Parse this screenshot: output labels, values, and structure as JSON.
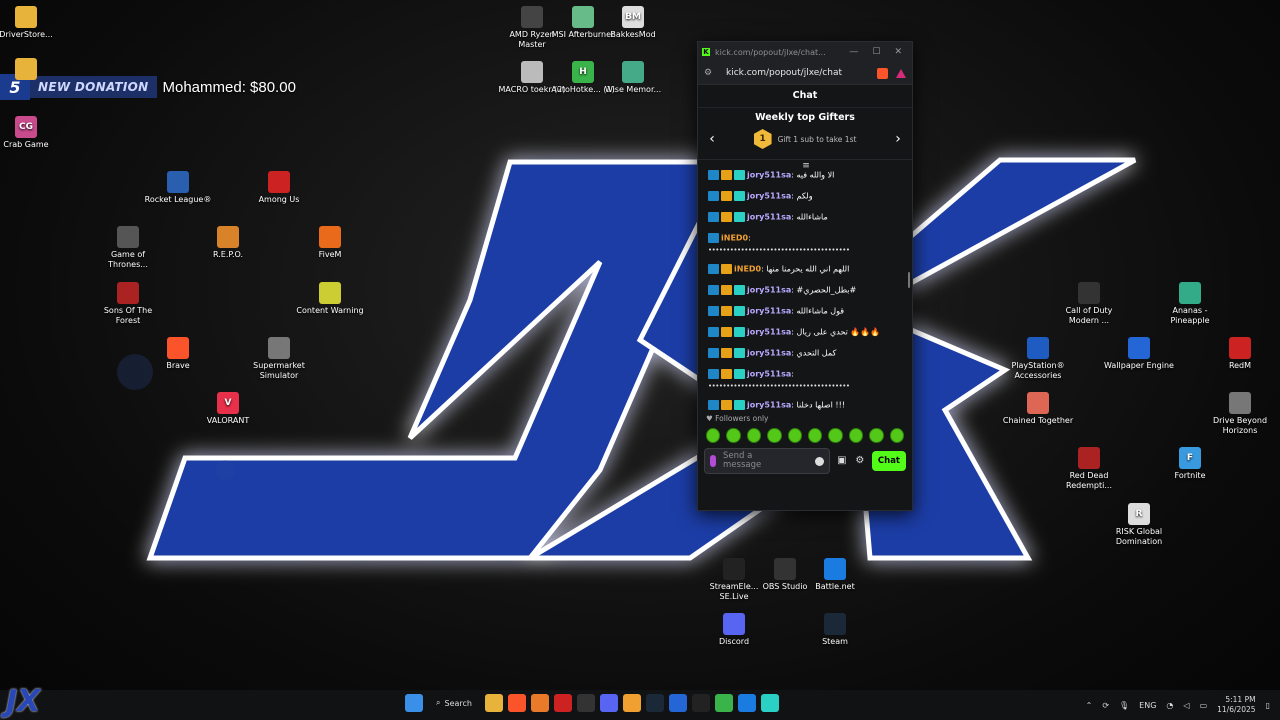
{
  "donation": {
    "badge": "5",
    "label": "NEW DONATION",
    "text": "Mohammed: $80.00"
  },
  "desktop_icons": [
    {
      "label": "DriverStore...",
      "color": "#e8b33a",
      "glyph": ""
    },
    {
      "label": "",
      "color": "#e8b33a",
      "glyph": ""
    },
    {
      "label": "Crab Game",
      "color": "#c94a8d",
      "glyph": "CG"
    },
    {
      "label": "AMD Ryzen Master",
      "color": "#444",
      "glyph": ""
    },
    {
      "label": "MSI Afterburner",
      "color": "#6b8",
      "glyph": ""
    },
    {
      "label": "BakkesMod",
      "color": "#ddd",
      "glyph": "BM"
    },
    {
      "label": "MACRO toekr (2)",
      "color": "#bbb",
      "glyph": ""
    },
    {
      "label": "AutoHotke... (1)",
      "color": "#3ab34a",
      "glyph": "H"
    },
    {
      "label": "Wise Memor...",
      "color": "#4a8",
      "glyph": ""
    },
    {
      "label": "Rocket League®",
      "color": "#2a5fb0",
      "glyph": ""
    },
    {
      "label": "Among Us",
      "color": "#c22",
      "glyph": ""
    },
    {
      "label": "Game of Thrones...",
      "color": "#555",
      "glyph": ""
    },
    {
      "label": "R.E.P.O.",
      "color": "#d8822a",
      "glyph": ""
    },
    {
      "label": "FiveM",
      "color": "#e86a1a",
      "glyph": ""
    },
    {
      "label": "Sons Of The Forest",
      "color": "#a22",
      "glyph": ""
    },
    {
      "label": "Content Warning",
      "color": "#cc3",
      "glyph": ""
    },
    {
      "label": "Brave",
      "color": "#fb542b",
      "glyph": ""
    },
    {
      "label": "Supermarket Simulator",
      "color": "#777",
      "glyph": ""
    },
    {
      "label": "VALORANT",
      "color": "#e8304a",
      "glyph": "V"
    },
    {
      "label": "Call of Duty Modern ...",
      "color": "#333",
      "glyph": ""
    },
    {
      "label": "Ananas - Pineapple",
      "color": "#3a8",
      "glyph": ""
    },
    {
      "label": "PlayStation® Accessories",
      "color": "#1f5cc2",
      "glyph": ""
    },
    {
      "label": "Wallpaper Engine",
      "color": "#2466d6",
      "glyph": ""
    },
    {
      "label": "RedM",
      "color": "#c22",
      "glyph": ""
    },
    {
      "label": "Chained Together",
      "color": "#d65",
      "glyph": ""
    },
    {
      "label": "Drive Beyond Horizons",
      "color": "#777",
      "glyph": ""
    },
    {
      "label": "Red Dead Redempti...",
      "color": "#a22",
      "glyph": ""
    },
    {
      "label": "Fortnite",
      "color": "#3a9ae0",
      "glyph": "F"
    },
    {
      "label": "RISK Global Domination",
      "color": "#ddd",
      "glyph": "R"
    },
    {
      "label": "StreamEle... SE.Live",
      "color": "#222",
      "glyph": ""
    },
    {
      "label": "OBS Studio",
      "color": "#333",
      "glyph": ""
    },
    {
      "label": "Battle.net",
      "color": "#1a7ce0",
      "glyph": ""
    },
    {
      "label": "Discord",
      "color": "#5865f2",
      "glyph": ""
    },
    {
      "label": "Steam",
      "color": "#1b2838",
      "glyph": ""
    }
  ],
  "chat": {
    "titlebar": "kick.com/popout/jlxe/chat...",
    "url": "kick.com/popout/jlxe/chat",
    "header": "Chat",
    "gifters_title": "Weekly top Gifters",
    "gift_hint": "Gift 1 sub to take 1st",
    "medal": "1",
    "messages": [
      {
        "user": "jory511sa",
        "text": ": الا والله فيه",
        "color": "#b8a8ff",
        "badges": 3,
        "cont": ""
      },
      {
        "user": "jory511sa",
        "text": ": ولكم",
        "color": "#b8a8ff",
        "badges": 3,
        "cont": ""
      },
      {
        "user": "jory511sa",
        "text": ": ماشاءالله",
        "color": "#b8a8ff",
        "badges": 3,
        "cont": ""
      },
      {
        "user": "iNED0",
        "text": ":",
        "color": "#f0a030",
        "badges": 1,
        "cont": "•••••••••••••••••••••••••••••••••••••••"
      },
      {
        "user": "iNED0",
        "text": ": اللهم اني الله يحرمنا منها",
        "color": "#f0a030",
        "badges": 2,
        "cont": ""
      },
      {
        "user": "jory511sa",
        "text": ": #بطل_الحصري#",
        "color": "#b8a8ff",
        "badges": 3,
        "cont": ""
      },
      {
        "user": "jory511sa",
        "text": ": قول ماشاءالله",
        "color": "#b8a8ff",
        "badges": 3,
        "cont": ""
      },
      {
        "user": "jory511sa",
        "text": ": تحدي على ريال 🔥🔥🔥",
        "color": "#b8a8ff",
        "badges": 3,
        "cont": ""
      },
      {
        "user": "jory511sa",
        "text": ": كمل التحدي",
        "color": "#b8a8ff",
        "badges": 3,
        "cont": ""
      },
      {
        "user": "jory511sa",
        "text": ":",
        "color": "#b8a8ff",
        "badges": 3,
        "cont": "•••••••••••••••••••••••••••••••••••••••"
      },
      {
        "user": "jory511sa",
        "text": ": اصلها دخلنا !!!",
        "color": "#b8a8ff",
        "badges": 3,
        "cont": ""
      }
    ],
    "followers_only": "Followers only",
    "input_placeholder": "Send a message",
    "send_label": "Chat"
  },
  "taskbar": {
    "logo": "JX",
    "search": "Search",
    "lang": "ENG",
    "time": "5:11 PM",
    "date": "11/6/2025"
  }
}
